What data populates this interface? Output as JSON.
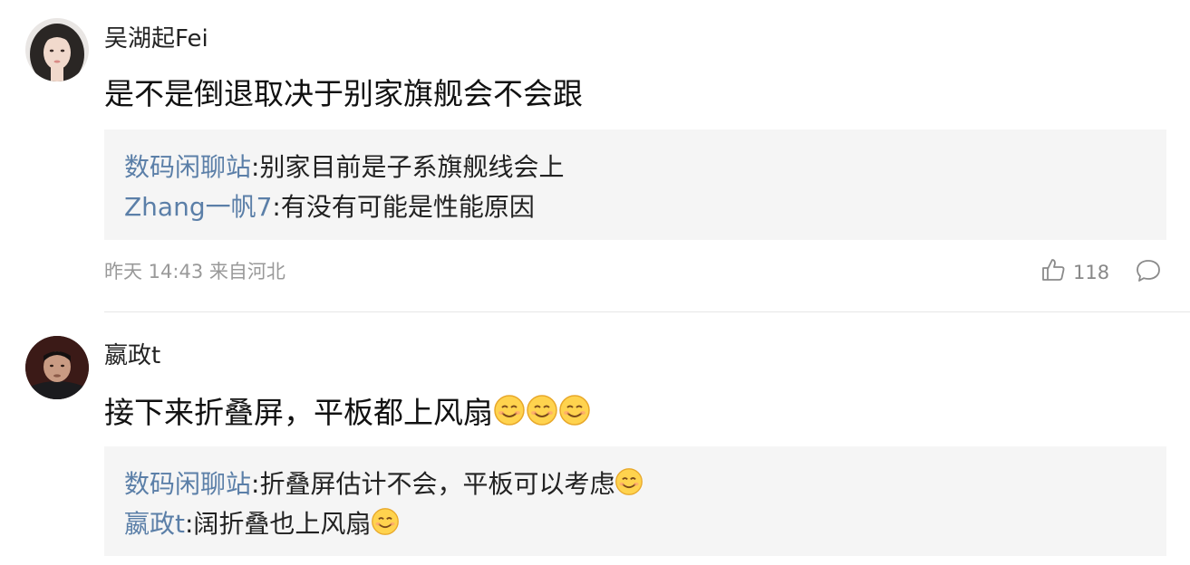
{
  "comments": [
    {
      "username": "吴湖起Fei",
      "text": "是不是倒退取决于别家旗舰会不会跟",
      "replies": [
        {
          "name": "数码闲聊站",
          "text": ":别家目前是子系旗舰线会上"
        },
        {
          "name": "Zhang一帆7",
          "text": ":有没有可能是性能原因"
        }
      ],
      "meta": "昨天 14:43 来自河北",
      "likes": "118"
    },
    {
      "username": "嬴政t",
      "text": "接下来折叠屏，平板都上风扇",
      "replies": [
        {
          "name": "数码闲聊站",
          "text": ":折叠屏估计不会，平板可以考虑"
        },
        {
          "name": "嬴政t",
          "text": ":阔折叠也上风扇"
        }
      ]
    }
  ],
  "colors": {
    "reply_name": "#5b7fa8",
    "reply_bg": "#f5f5f5",
    "meta": "#999999"
  },
  "icons": {
    "like": "thumbs-up-icon",
    "reply": "comment-bubble-icon",
    "emoji": "smile-emoji-icon"
  }
}
